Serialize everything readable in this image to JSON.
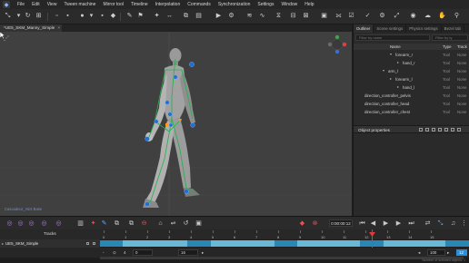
{
  "menu": [
    "File",
    "Edit",
    "View",
    "Tween machine",
    "Mirror tool",
    "Timeline",
    "Interpolation",
    "Commands",
    "Synchronization",
    "Settings",
    "Window",
    "Help"
  ],
  "scene_tab": {
    "label": "*UE5_SKM_Manny_Simple",
    "close": "×"
  },
  "viewport": {
    "watermark": "Cascadeur_AE3 Base"
  },
  "right_panel": {
    "tabs": [
      "Outliner",
      "Scene settings",
      "Physics settings",
      "Bezel tab"
    ],
    "filter_name_placeholder": "Filter by name",
    "filter_type_placeholder": "Filter by ty",
    "columns": {
      "name": "Name",
      "type": "Type",
      "track": "Track"
    },
    "rows": [
      {
        "name": "forearm_r",
        "type": "Tool",
        "track": "None",
        "indent": 2,
        "arrow": "▾"
      },
      {
        "name": "hand_r",
        "type": "Tool",
        "track": "None",
        "indent": 3,
        "arrow": "▸"
      },
      {
        "name": "arm_l",
        "type": "Tool",
        "track": "None",
        "indent": 1,
        "arrow": "▾"
      },
      {
        "name": "forearm_l",
        "type": "Tool",
        "track": "None",
        "indent": 2,
        "arrow": "▸"
      },
      {
        "name": "hand_l",
        "type": "Tool",
        "track": "None",
        "indent": 3,
        "arrow": "▸"
      },
      {
        "name": "direction_controller_pelvis",
        "type": "Tool",
        "track": "None",
        "indent": 0,
        "arrow": ""
      },
      {
        "name": "direction_controller_head",
        "type": "Tool",
        "track": "None",
        "indent": 0,
        "arrow": ""
      },
      {
        "name": "direction_controller_chest",
        "type": "Tool",
        "track": "None",
        "indent": 0,
        "arrow": ""
      }
    ],
    "object_properties_label": "Object properties"
  },
  "timeline": {
    "timecode": "0:00:00:12",
    "tracks_label": "Tracks",
    "track_name": "UE5_SKM_Simple",
    "ruler_ticks": [
      "0",
      "1",
      "2",
      "3",
      "4",
      "5",
      "6",
      "7",
      "8",
      "9",
      "10",
      "11",
      "12",
      "13",
      "14",
      "15"
    ],
    "current_frame": "12",
    "start_frame": "0",
    "end_frame": "16",
    "step": "4",
    "zoom": "100"
  },
  "status_text": "Number of selected objects: 1",
  "colors": {
    "accent": "#2d8fd6",
    "track": "#68b9d8",
    "key": "#2a86b4",
    "playhead": "#e03a3a",
    "joint": "#1f6fd6",
    "rig": "#1da94a"
  }
}
